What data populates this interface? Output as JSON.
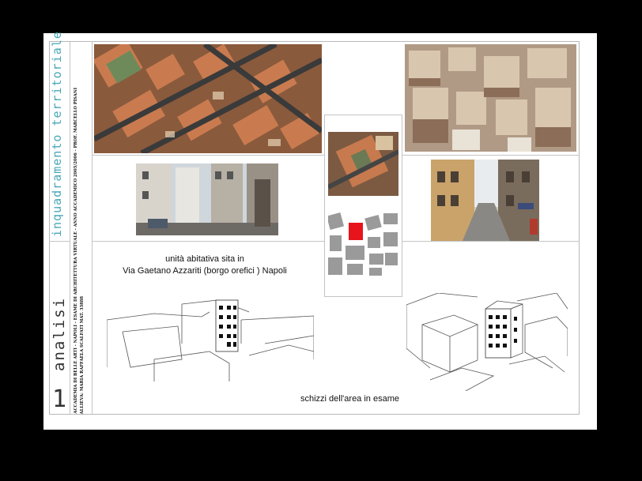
{
  "sheet": {
    "title_top": "inquadramento territoriale",
    "title_bottom": "analisi",
    "page_number": "1",
    "credits": [
      "ACCADEMIA DI BELLE ARTI - NAPOLI - ESAME DI ARCHITETTURA VIRTUALE - ANNO ACCADEMICO 2005/2006 - PROF. MARCELLO PISANI",
      "ALLIEVA: MARIA RAFFAELA SCALFATI MAT. 33888"
    ]
  },
  "captions": {
    "address_line1": "unità abitativa sita in",
    "address_line2": "Via Gaetano Azzariti (borgo orefici ) Napoli",
    "sketches": "schizzi dell'area in esame"
  },
  "colors": {
    "title_accent": "#49a7b7",
    "highlight_block": "#e8141b",
    "frame": "#b8b8b8"
  }
}
